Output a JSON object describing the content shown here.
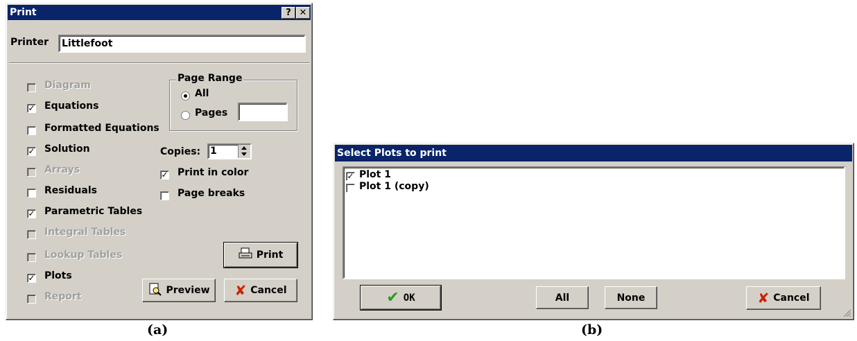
{
  "print_dialog": {
    "title": "Print",
    "help_btn": "?",
    "close_btn": "✕",
    "printer_label": "Printer",
    "printer_value": "Littlefoot",
    "options": [
      {
        "label": "Diagram",
        "checked": false,
        "enabled": false
      },
      {
        "label": "Equations",
        "checked": true,
        "enabled": true
      },
      {
        "label": "Formatted Equations",
        "checked": false,
        "enabled": true
      },
      {
        "label": "Solution",
        "checked": true,
        "enabled": true
      },
      {
        "label": "Arrays",
        "checked": false,
        "enabled": false
      },
      {
        "label": "Residuals",
        "checked": false,
        "enabled": true
      },
      {
        "label": "Parametric Tables",
        "checked": true,
        "enabled": true
      },
      {
        "label": "Integral Tables",
        "checked": false,
        "enabled": false
      },
      {
        "label": "Lookup Tables",
        "checked": false,
        "enabled": false
      },
      {
        "label": "Plots",
        "checked": true,
        "enabled": true
      },
      {
        "label": "Report",
        "checked": false,
        "enabled": false
      }
    ],
    "page_range_title": "Page Range",
    "range_all": "All",
    "range_pages": "Pages",
    "copies_label": "Copies:",
    "copies_value": "1",
    "print_in_color": "Print in color",
    "page_breaks": "Page breaks",
    "print_btn": "Print",
    "preview_btn": "Preview",
    "cancel_btn": "Cancel"
  },
  "plots_dialog": {
    "title": "Select Plots to print",
    "items": [
      {
        "label": "Plot 1",
        "checked": true
      },
      {
        "label": "Plot 1 (copy)",
        "checked": false
      }
    ],
    "ok_btn": "OK",
    "all_btn": "All",
    "none_btn": "None",
    "cancel_btn": "Cancel"
  },
  "captions": {
    "a": "(a)",
    "b": "(b)"
  },
  "colors": {
    "titlebar": "#0a246a",
    "face": "#d4d0c8",
    "cancel_x": "#cc2200",
    "ok_check": "#2e9a1a"
  }
}
